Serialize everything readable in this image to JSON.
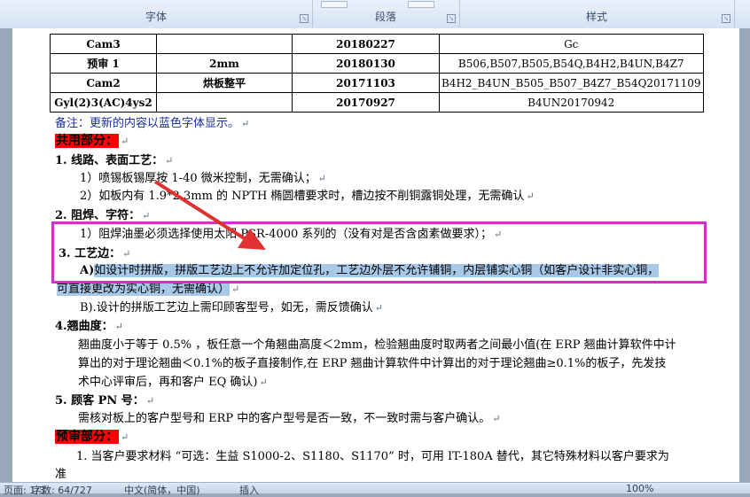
{
  "ribbon": {
    "groups": [
      "字体",
      "段落",
      "样式"
    ],
    "accent": "#d5e2f3"
  },
  "table": {
    "rows": [
      [
        "Cam3",
        "",
        "20180227",
        "Gc"
      ],
      [
        "预审 1",
        "2mm",
        "20180130",
        "B506,B507,B505,B54Q,B4H2,B4UN,B4Z7"
      ],
      [
        "Cam2",
        "烘板整平",
        "20171103",
        "B4H2_B4UN_B505_B507_B4Z7_B54Q20171109"
      ],
      [
        "Gyl(2)3(AC)4ys2",
        "",
        "20170927",
        "B4UN20170942"
      ]
    ]
  },
  "doc": {
    "note": "备注：更新的内容以蓝色字体显示。",
    "common_heading": "共用部分：",
    "s1_title": "1.   线路、表面工艺：",
    "s1_l1": "1）喷锡板锡厚按 1-40 微米控制，无需确认；",
    "s1_l2": "2）如板内有 1.9*2.3mm 的 NPTH 椭圆槽要求时，槽边按不削铜露铜处理，无需确认",
    "s2_title": "2.   阻焊、字符：",
    "s2_l1": "1）阻焊油墨必须选择使用太阳 PSR-4000 系列的（没有对是否含卤素做要求）；",
    "s3_title": "3. 工艺边：",
    "s3_a_prefix": "A)",
    "s3_a_text": "如设计时拼版，拼版工艺边上不允许加定位孔，工艺边外层不允许铺铜，内层铺实心铜（如客户设计非实心铜，",
    "s3_a_cont": "可直接更改为实心铜，无需确认）",
    "s3_b": "B).设计的拼版工艺边上需印顾客型号，如无，需反馈确认",
    "s4_title": "4.翘曲度：",
    "s4_l1": "翘曲度小于等于 0.5% ，板任意一个角翘曲高度＜2mm，检验翘曲度时取两者之间最小值(在 ERP 翘曲计算软件中计",
    "s4_l2": "算出的对于理论翘曲＜0.1%的板子直接制作,在 ERP 翘曲计算软件中计算出的对于理论翘曲≥0.1%的板子，先发技",
    "s4_l3": "术中心评审后，再和客户 EQ 确认)",
    "s5_title": "5. 顾客 PN 号：",
    "s5_l1": "需核对板上的客户型号和 ERP 中的客户型号是否一致，不一致时需与客户确认。",
    "pre_heading": "预审部分：",
    "p1_l1": "1.  当客户要求材料 “可选：生益 S1000-2、S1180、S1170” 时，可用 IT-180A 替代，其它特殊材料以客户要求为",
    "p1_l2": "准",
    "para_mark": "↵"
  },
  "status": {
    "page": "页面: 1/3",
    "words": "字数: 64/727",
    "lang": "中文(简体，中国)",
    "mode": "插入",
    "zoom": "100%"
  },
  "colors": {
    "highlight_box": "#cc33cc",
    "arrow": "#e03030",
    "heading_bg": "#ff0000",
    "selection": "#a8c8e8",
    "blue_text": "#1a2ea0"
  }
}
